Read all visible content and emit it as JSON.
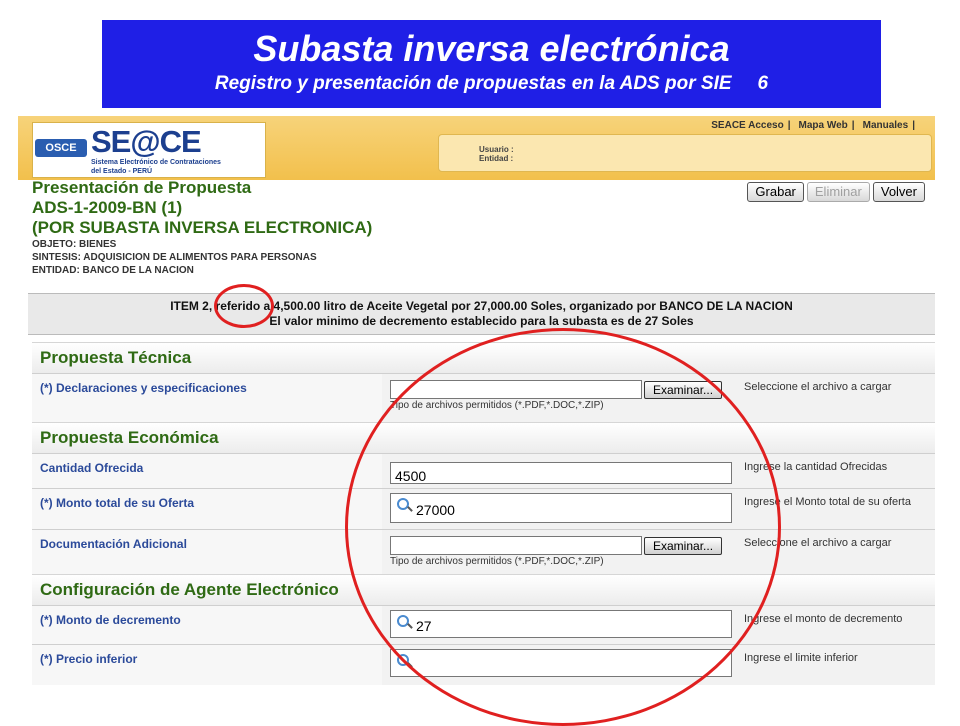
{
  "banner": {
    "title": "Subasta inversa electrónica",
    "subtitle": "Registro y presentación de propuestas en la ADS por SIE",
    "slide_number": "6"
  },
  "header": {
    "logo_osce": "OSCE",
    "logo_text": "SE@CE",
    "logo_line1": "Sistema Electrónico de Contrataciones",
    "logo_line2": "del Estado - PERÚ",
    "links": [
      "SEACE Acceso",
      "Mapa Web",
      "Manuales"
    ],
    "usuario_label": "Usuario :",
    "entidad_label": "Entidad :"
  },
  "page": {
    "title1": "Presentación de Propuesta",
    "title2": "ADS-1-2009-BN (1)",
    "title3": "(POR SUBASTA INVERSA ELECTRONICA)",
    "objeto": "OBJETO: BIENES",
    "sintesis": "SINTESIS: ADQUISICION DE ALIMENTOS PARA PERSONAS",
    "entidad": "ENTIDAD: BANCO DE LA NACION"
  },
  "buttons": {
    "grabar": "Grabar",
    "eliminar": "Eliminar",
    "volver": "Volver"
  },
  "item": {
    "line1": "ITEM 2, referido a 4,500.00 litro de Aceite Vegetal  por 27,000.00 Soles, organizado por BANCO DE LA NACION",
    "line2": "El valor minimo de decremento establecido para la subasta es de 27 Soles"
  },
  "sections": {
    "tecnica": "Propuesta Técnica",
    "economica": "Propuesta Económica",
    "agente": "Configuración de Agente Electrónico"
  },
  "fields": {
    "declaraciones": {
      "label": "(*) Declaraciones y especificaciones",
      "button": "Examinar...",
      "types": "Tipo de archivos permitidos (*.PDF,*.DOC,*.ZIP)",
      "hint": "Seleccione el archivo a cargar"
    },
    "cantidad": {
      "label": "Cantidad Ofrecida",
      "value": "4500",
      "hint": "Ingrese la cantidad Ofrecidas"
    },
    "monto": {
      "label": "(*) Monto total de su Oferta",
      "value": "27000",
      "hint": "Ingrese el Monto total de su oferta"
    },
    "documentacion": {
      "label": "Documentación Adicional",
      "button": "Examinar...",
      "types": "Tipo de archivos permitidos (*.PDF,*.DOC,*.ZIP)",
      "hint": "Seleccione el archivo a cargar"
    },
    "decremento": {
      "label": "(*) Monto de decremento",
      "value": "27",
      "hint": "Ingrese el monto de decremento"
    },
    "precio": {
      "label": "(*) Precio inferior",
      "value": "",
      "hint": "Ingrese el limite inferior"
    }
  }
}
